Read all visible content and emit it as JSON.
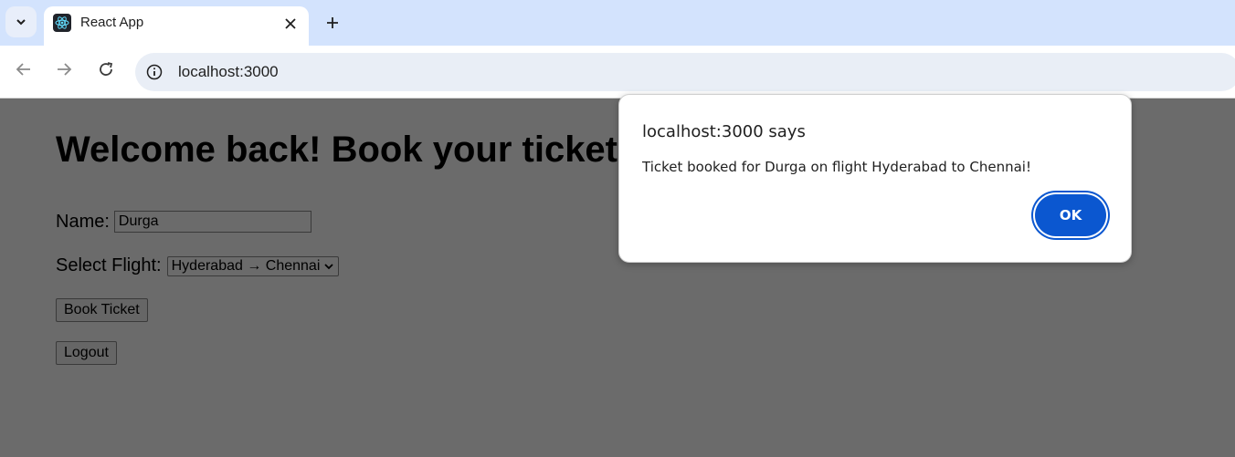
{
  "browser": {
    "tab": {
      "title": "React App"
    },
    "address_bar": {
      "url": "localhost:3000"
    },
    "icons": [
      "tab-search-icon",
      "react-favicon-icon",
      "close-icon",
      "plus-icon",
      "back-arrow-icon",
      "forward-arrow-icon",
      "reload-icon",
      "site-info-icon"
    ]
  },
  "page": {
    "heading": "Welcome back! Book your ticket",
    "name_label": "Name:",
    "name_value": "Durga",
    "flight_label": "Select Flight:",
    "flight_selected": "Hyderabad → Chennai",
    "book_button": "Book Ticket",
    "logout_button": "Logout"
  },
  "dialog": {
    "title": "localhost:3000 says",
    "message": "Ticket booked for Durga on flight Hyderabad to Chennai!",
    "ok_label": "OK"
  },
  "colors": {
    "tabstrip": "#d3e3fd",
    "overlay": "#6b6b6b",
    "accent": "#0b57d0"
  }
}
